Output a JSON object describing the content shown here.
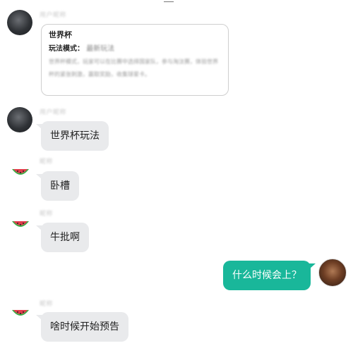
{
  "chat": {
    "card": {
      "title": "世界杯",
      "mode_label": "玩法模式：",
      "mode_value": "最新玩法",
      "body": "世界杯模式，玩家可以在比赛中选择国家队，参与淘汰赛，体验世界杯的紧张刺激，赢取奖励，收集球星卡。"
    },
    "messages": [
      {
        "text": "世界杯玩法",
        "nick": "用户昵称"
      },
      {
        "text": "卧槽",
        "nick": "昵称"
      },
      {
        "text": "牛批啊",
        "nick": "昵称"
      },
      {
        "text": "什么时候会上？",
        "mine": true
      },
      {
        "text": "啥时候开始预告",
        "nick": "昵称"
      }
    ],
    "colors": {
      "mine_bubble": "#19b79a",
      "other_bubble": "#e9eaec"
    },
    "icons": {
      "watermelon": "watermelon-avatar-icon"
    }
  }
}
